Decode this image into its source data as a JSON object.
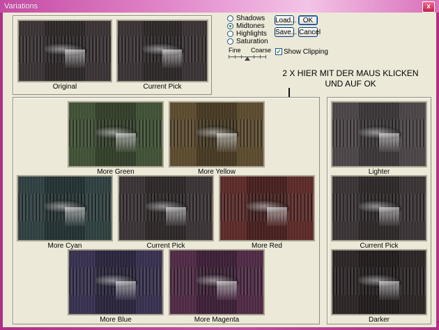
{
  "window": {
    "title": "Variations",
    "close_label": "x"
  },
  "controls": {
    "options": [
      {
        "label": "Shadows",
        "selected": false
      },
      {
        "label": "Midtones",
        "selected": true
      },
      {
        "label": "Highlights",
        "selected": false
      },
      {
        "label": "Saturation",
        "selected": false
      }
    ],
    "load_label": "Load...",
    "ok_label": "OK",
    "save_label": "Save...",
    "cancel_label": "Cancel",
    "fine_label": "Fine",
    "coarse_label": "Coarse",
    "show_clipping_label": "Show Clipping",
    "show_clipping_checked": true
  },
  "top_thumbs": {
    "original": "Original",
    "current_pick": "Current Pick"
  },
  "color_grid": {
    "more_green": "More Green",
    "more_yellow": "More Yellow",
    "more_cyan": "More Cyan",
    "current_pick": "Current Pick",
    "more_red": "More Red",
    "more_blue": "More Blue",
    "more_magenta": "More Magenta"
  },
  "light_column": {
    "lighter": "Lighter",
    "current_pick": "Current Pick",
    "darker": "Darker"
  },
  "annotation": {
    "line1": "2 X HIER MIT DER MAUS KLICKEN",
    "line2": "UND AUF OK"
  },
  "colors": {
    "neutral": "#3a3234",
    "green": "#3f5035",
    "yellow": "#5a4a2e",
    "cyan": "#2f3f40",
    "red": "#5a2a28",
    "blue": "#37304e",
    "magenta": "#4e2a44",
    "lighter": "#4b4446",
    "darker": "#2c2526"
  }
}
